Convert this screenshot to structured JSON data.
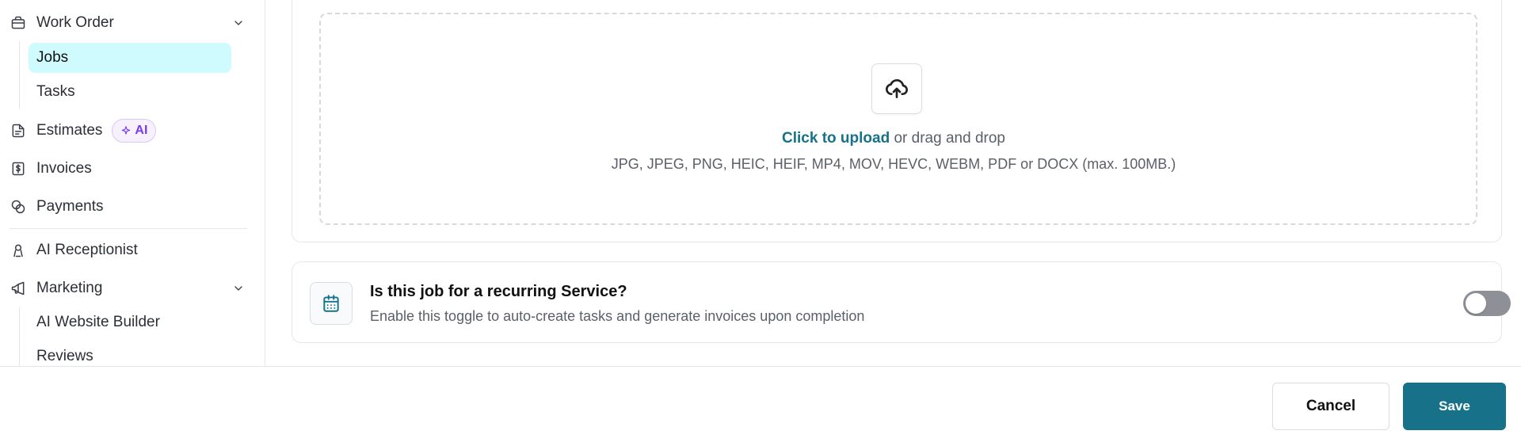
{
  "sidebar": {
    "work_order": {
      "label": "Work Order",
      "icon": "briefcase-icon",
      "expanded": true,
      "children": [
        {
          "label": "Jobs",
          "active": true
        },
        {
          "label": "Tasks",
          "active": false
        }
      ]
    },
    "estimates": {
      "label": "Estimates",
      "icon": "file-list-icon",
      "badge": "AI"
    },
    "invoices": {
      "label": "Invoices",
      "icon": "invoice-dollar-icon"
    },
    "payments": {
      "label": "Payments",
      "icon": "coins-icon"
    },
    "ai_receptionist": {
      "label": "AI Receptionist",
      "icon": "receptionist-icon"
    },
    "marketing": {
      "label": "Marketing",
      "icon": "megaphone-icon",
      "expanded": true,
      "children": [
        {
          "label": "AI Website Builder"
        },
        {
          "label": "Reviews"
        }
      ]
    }
  },
  "upload": {
    "icon": "cloud-upload-icon",
    "link_text": "Click to upload",
    "rest_text": " or drag and drop",
    "formats": "JPG, JPEG, PNG, HEIC, HEIF, MP4, MOV, HEVC, WEBM, PDF or DOCX (max. 100MB.)"
  },
  "recurring": {
    "icon": "calendar-icon",
    "title": "Is this job for a recurring Service?",
    "description": "Enable this toggle to auto-create tasks and generate invoices upon completion",
    "enabled": false
  },
  "footer": {
    "cancel_label": "Cancel",
    "save_label": "Save"
  },
  "colors": {
    "accent": "#177289",
    "active_bg": "#cffafe",
    "ai_badge": "#7c3aed",
    "toggle_off": "#8d9097"
  }
}
